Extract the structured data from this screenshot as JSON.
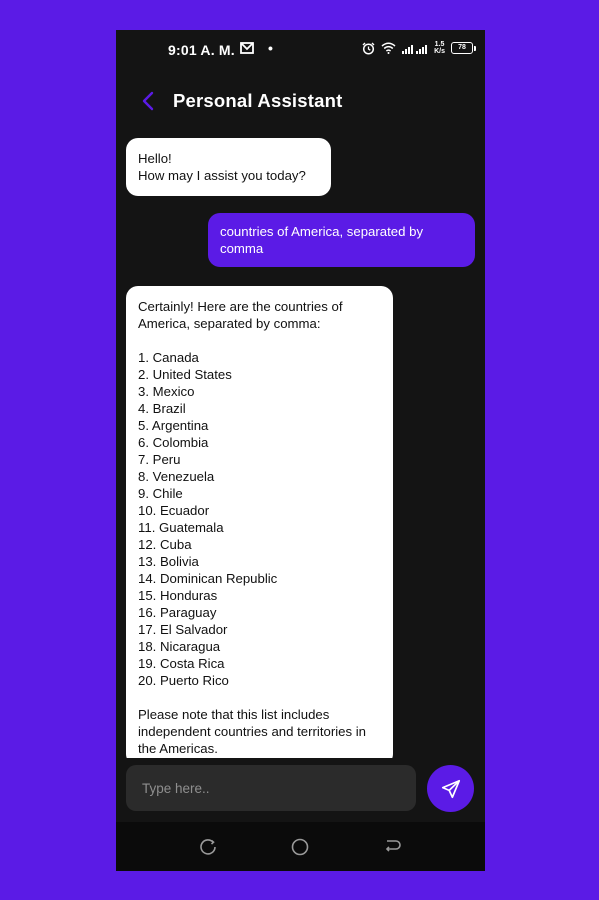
{
  "status_bar": {
    "time": "9:01 A. M.",
    "dot": "•",
    "net_speed_top": "1.5",
    "net_speed_bottom": "K/s",
    "battery": "78"
  },
  "header": {
    "title": "Personal Assistant",
    "icons": {
      "back": "chevron-left-icon"
    }
  },
  "messages": [
    {
      "sender": "assistant",
      "text": "Hello!\nHow may I assist you today?"
    },
    {
      "sender": "user",
      "text": "countries of America, separated by comma"
    },
    {
      "sender": "assistant",
      "text": "Certainly! Here are the countries of America, separated by comma:\n\n1. Canada\n2. United States\n3. Mexico\n4. Brazil\n5. Argentina\n6. Colombia\n7. Peru\n8. Venezuela\n9. Chile\n10. Ecuador\n11. Guatemala\n12. Cuba\n13. Bolivia\n14. Dominican Republic\n15. Honduras\n16. Paraguay\n17. El Salvador\n18. Nicaragua\n19. Costa Rica\n20. Puerto Rico\n\nPlease note that this list includes independent countries and territories in the Americas."
    }
  ],
  "composer": {
    "placeholder": "Type here..",
    "send_icon": "send-icon"
  },
  "nav_bar": {
    "icons": [
      "recent-apps-icon",
      "home-icon",
      "back-icon"
    ]
  },
  "colors": {
    "accent": "#5b1be6",
    "screen_bg": "#141414",
    "bot_bubble": "#ffffff",
    "input_bg": "#2b2b2b"
  }
}
